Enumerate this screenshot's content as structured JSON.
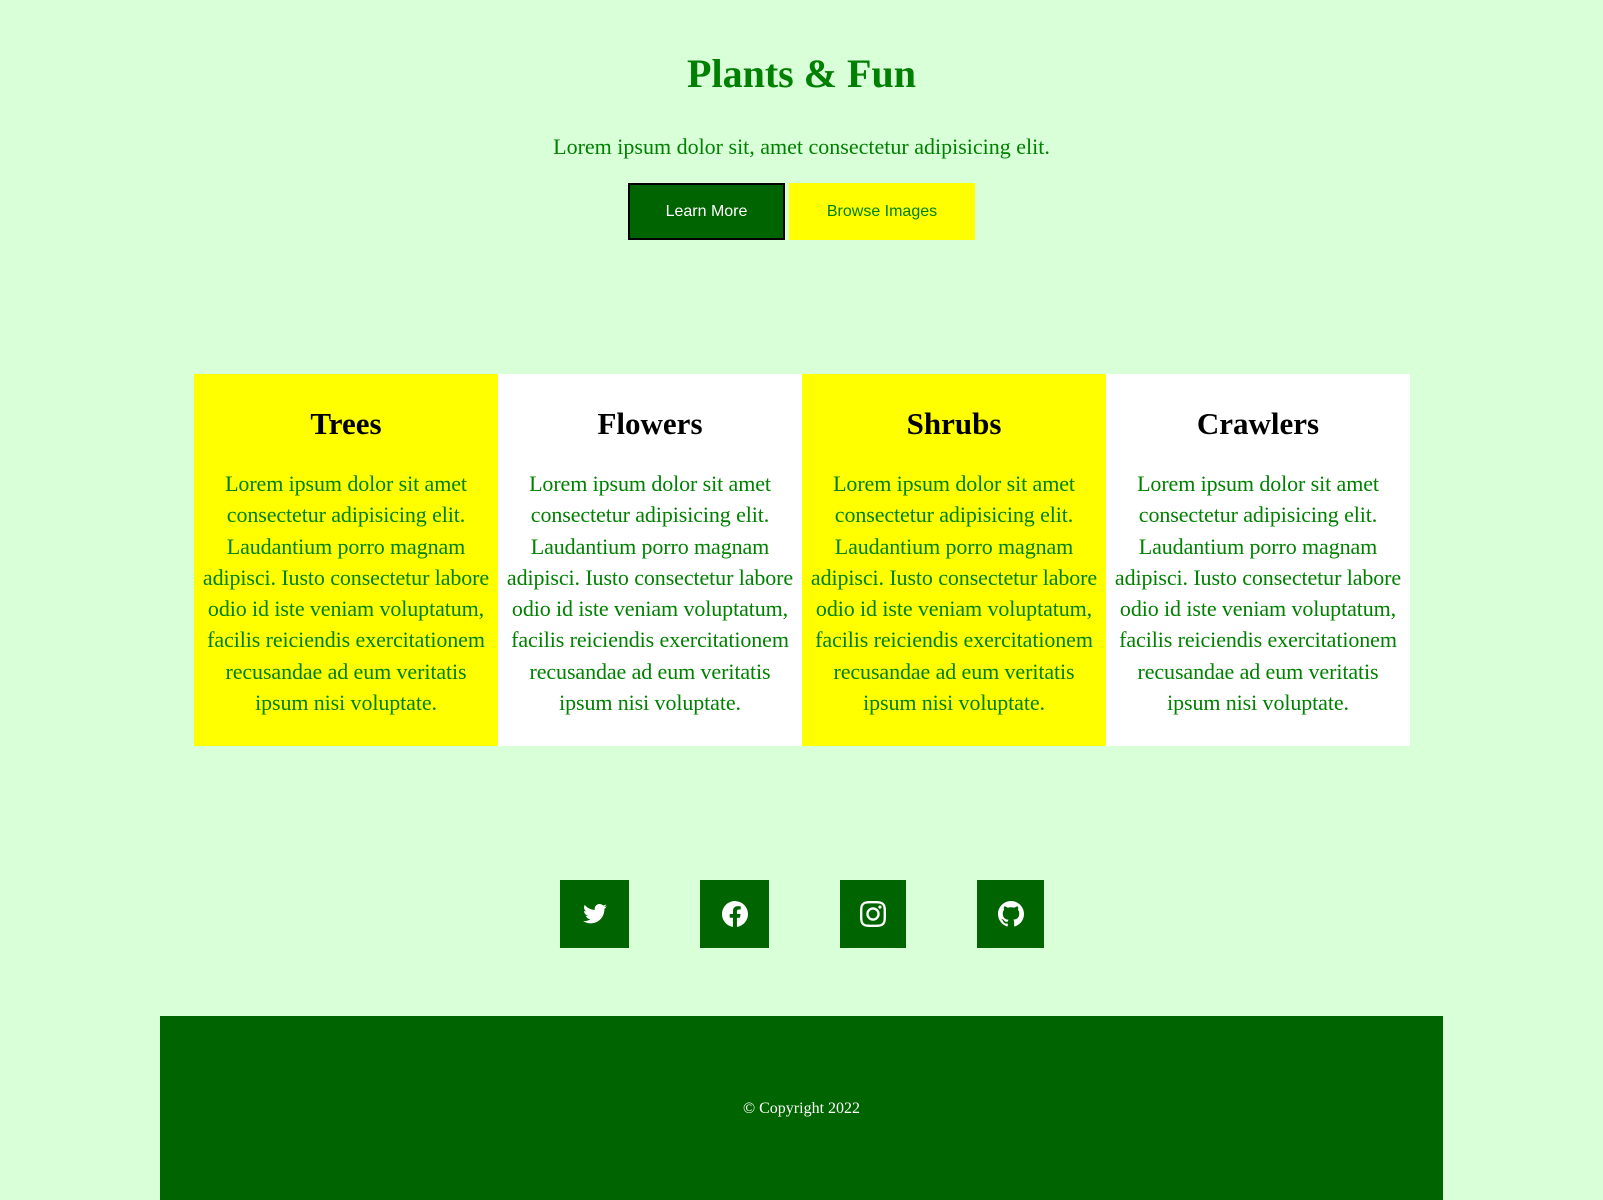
{
  "hero": {
    "title": "Plants & Fun",
    "subtitle": "Lorem ipsum dolor sit, amet consectetur adipisicing elit.",
    "learn_more_label": "Learn More",
    "browse_images_label": "Browse Images"
  },
  "cards": [
    {
      "title": "Trees",
      "text": "Lorem ipsum dolor sit amet\nconsectetur adipisicing elit.\nLaudantium porro magnam\nadipisci. Iusto consectetur labore\nodio id iste veniam voluptatum,\nfacilis reiciendis exercitationem\nrecusandae ad eum veritatis\nipsum nisi voluptate."
    },
    {
      "title": "Flowers",
      "text": "Lorem ipsum dolor sit amet\nconsectetur adipisicing elit.\nLaudantium porro magnam\nadipisci. Iusto consectetur labore\nodio id iste veniam voluptatum,\nfacilis reiciendis exercitationem\nrecusandae ad eum veritatis\nipsum nisi voluptate."
    },
    {
      "title": "Shrubs",
      "text": "Lorem ipsum dolor sit amet\nconsectetur adipisicing elit.\nLaudantium porro magnam\nadipisci. Iusto consectetur labore\nodio id iste veniam voluptatum,\nfacilis reiciendis exercitationem\nrecusandae ad eum veritatis\nipsum nisi voluptate."
    },
    {
      "title": "Crawlers",
      "text": "Lorem ipsum dolor sit amet\nconsectetur adipisicing elit.\nLaudantium porro magnam\nadipisci. Iusto consectetur labore\nodio id iste veniam voluptatum,\nfacilis reiciendis exercitationem\nrecusandae ad eum veritatis\nipsum nisi voluptate."
    }
  ],
  "social": {
    "icons": [
      "twitter-icon",
      "facebook-icon",
      "instagram-icon",
      "github-icon"
    ]
  },
  "footer": {
    "copyright": "© Copyright 2022"
  },
  "colors": {
    "page_background": "#d9ffd9",
    "primary_green": "#006400",
    "text_green": "#008000",
    "accent_yellow": "#ffff00",
    "card_white": "#ffffff"
  }
}
